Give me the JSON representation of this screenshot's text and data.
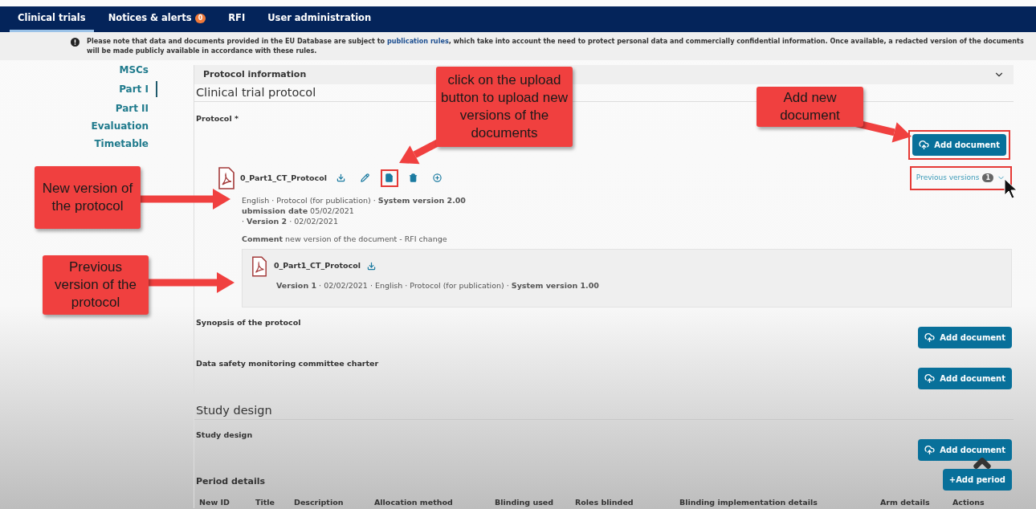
{
  "nav": {
    "tabs": [
      {
        "label": "Clinical trials",
        "selected": true
      },
      {
        "label": "Notices & alerts",
        "badge": "0",
        "selected": false
      },
      {
        "label": "RFI",
        "selected": false
      },
      {
        "label": "User administration",
        "selected": false
      }
    ]
  },
  "notice": {
    "before": "Please note that data and documents provided in the EU Database are subject to",
    "link": "publication rules",
    "after": ", which take into account the need to protect personal data and commercially confidential information. Once available, a redacted version of the documents will be made publicly available in accordance with these rules."
  },
  "sidebar": {
    "items": [
      {
        "label": "MSCs",
        "selected": false
      },
      {
        "label": "Part I",
        "selected": true
      },
      {
        "label": "Part II",
        "selected": false
      },
      {
        "label": "Evaluation",
        "selected": false
      },
      {
        "label": "Timetable",
        "selected": false
      }
    ]
  },
  "section": {
    "title": "Protocol information",
    "heading": "Clinical trial protocol",
    "protocol": {
      "label": "Protocol *",
      "add_button": {
        "label": "Add document",
        "highlighted": true
      },
      "document": {
        "name": "0_Part1_CT_Protocol",
        "actions": [
          {
            "kind": "download",
            "highlighted": false
          },
          {
            "kind": "edit",
            "highlighted": false
          },
          {
            "kind": "upload",
            "highlighted": true
          },
          {
            "kind": "delete",
            "highlighted": false
          },
          {
            "kind": "add",
            "highlighted": false
          }
        ],
        "meta": [
          "English · Protocol (for publication) · **System version 2.00**",
          "**ubmission date** 05/02/2021",
          "· **Version 2** · 02/02/2021"
        ],
        "comment": "**Comment** new version of the document - RFI change"
      },
      "previous_versions": {
        "label": "Previous versions",
        "count": "1",
        "highlighted": true,
        "items": [
          {
            "name": "0_Part1_CT_Protocol",
            "meta": "**Version 1** · 02/02/2021 · English · Protocol (for publication) · **System version 1.00**"
          }
        ]
      }
    },
    "fields": [
      {
        "label": "Synopsis of the protocol",
        "button": "Add document"
      },
      {
        "label": "Data safety monitoring committee charter",
        "button": "Add document"
      }
    ]
  },
  "study_design": {
    "heading": "Study design",
    "fields": [
      {
        "label": "Study design",
        "button": "Add document"
      }
    ],
    "period": {
      "label": "Period details",
      "button": "+Add period",
      "columns": [
        "New ID",
        "Title",
        "Description",
        "Allocation method",
        "Blinding used",
        "Roles blinded",
        "Blinding implementation details",
        "Arm details",
        "Actions"
      ]
    }
  },
  "callouts": [
    {
      "text": "click on the upload button to upload new versions of the documents"
    },
    {
      "text": "Add new document"
    },
    {
      "text": "New version of the protocol"
    },
    {
      "text": "Previous version of the protocol"
    }
  ]
}
